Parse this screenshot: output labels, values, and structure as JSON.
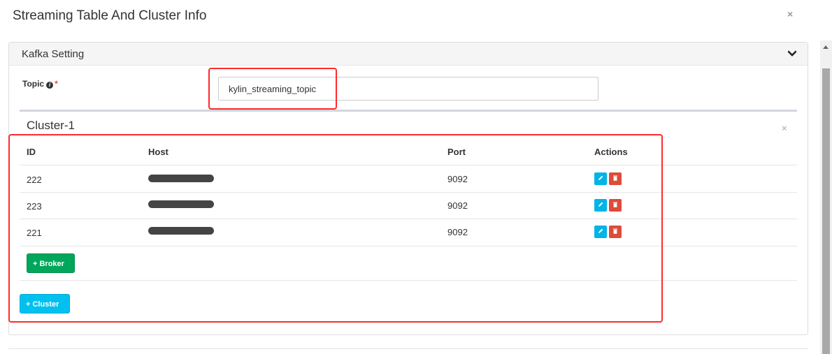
{
  "modal": {
    "title": "Streaming Table And Cluster Info",
    "close_symbol": "×"
  },
  "kafka": {
    "panel_title": "Kafka Setting",
    "topic_label": "Topic",
    "info_symbol": "i",
    "required_mark": "*",
    "topic_value": "kylin_streaming_topic"
  },
  "cluster": {
    "title": "Cluster-1",
    "close_symbol": "×",
    "columns": {
      "id": "ID",
      "host": "Host",
      "port": "Port",
      "actions": "Actions"
    },
    "rows": [
      {
        "id": "222",
        "port": "9092"
      },
      {
        "id": "223",
        "port": "9092"
      },
      {
        "id": "221",
        "port": "9092"
      }
    ],
    "add_broker_label": "+ Broker",
    "add_cluster_label": "+ Cluster"
  },
  "colors": {
    "highlight": "#ff2a2a",
    "edit_button": "#00b4e6",
    "delete_button": "#dd4b39",
    "broker_button": "#00a65a",
    "cluster_button": "#00c0ef"
  },
  "icons": {
    "chevron": "chevron-down-icon",
    "info": "info-circle-icon",
    "edit": "pencil-icon",
    "delete": "trash-icon"
  }
}
